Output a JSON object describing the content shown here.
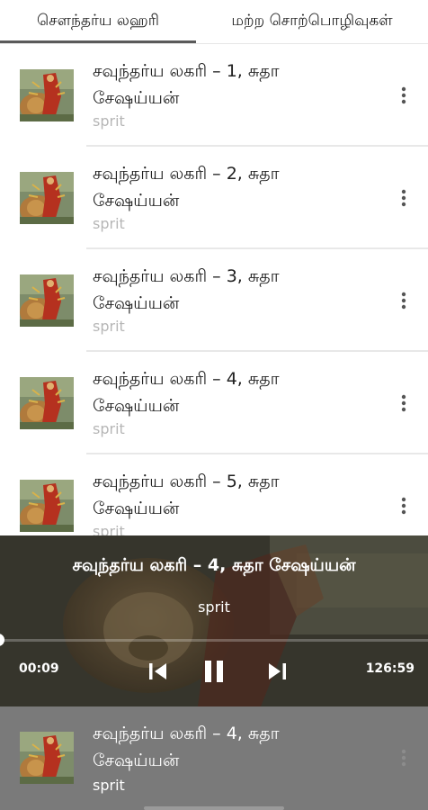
{
  "tabs": [
    {
      "label": "சௌந்தர்ய லஹரி",
      "selected": true
    },
    {
      "label": "மற்ற சொற்பொழிவுகள்",
      "selected": false
    }
  ],
  "tracks": [
    {
      "title": "சவுந்தர்ய லகரி – 1, சுதா சேஷய்யன்",
      "artist": "sprit"
    },
    {
      "title": "சவுந்தர்ய லகரி – 2, சுதா சேஷய்யன்",
      "artist": "sprit"
    },
    {
      "title": "சவுந்தர்ய லகரி – 3, சுதா சேஷய்யன்",
      "artist": "sprit"
    },
    {
      "title": "சவுந்தர்ய லகரி – 4, சுதா சேஷய்யன்",
      "artist": "sprit"
    },
    {
      "title": "சவுந்தர்ய லகரி – 5, சுதா சேஷய்யன்",
      "artist": "sprit"
    }
  ],
  "player": {
    "title": "சவுந்தர்ய லகரி – 4, சுதா சேஷய்யன்",
    "artist": "sprit",
    "current_time": "00:09",
    "total_time": "126:59",
    "progress": 0.0012,
    "state": "playing",
    "controls": [
      "skip-previous-icon",
      "pause-icon",
      "skip-next-icon"
    ]
  },
  "mini_player": {
    "title": "சவுந்தர்ய லகரி – 4, சுதா சேஷய்யன்",
    "artist": "sprit"
  },
  "colors": {
    "tab_indicator": "#5a5a5a",
    "subtitle": "#b6b6b6",
    "mini_bar": "#7a7a7a"
  }
}
